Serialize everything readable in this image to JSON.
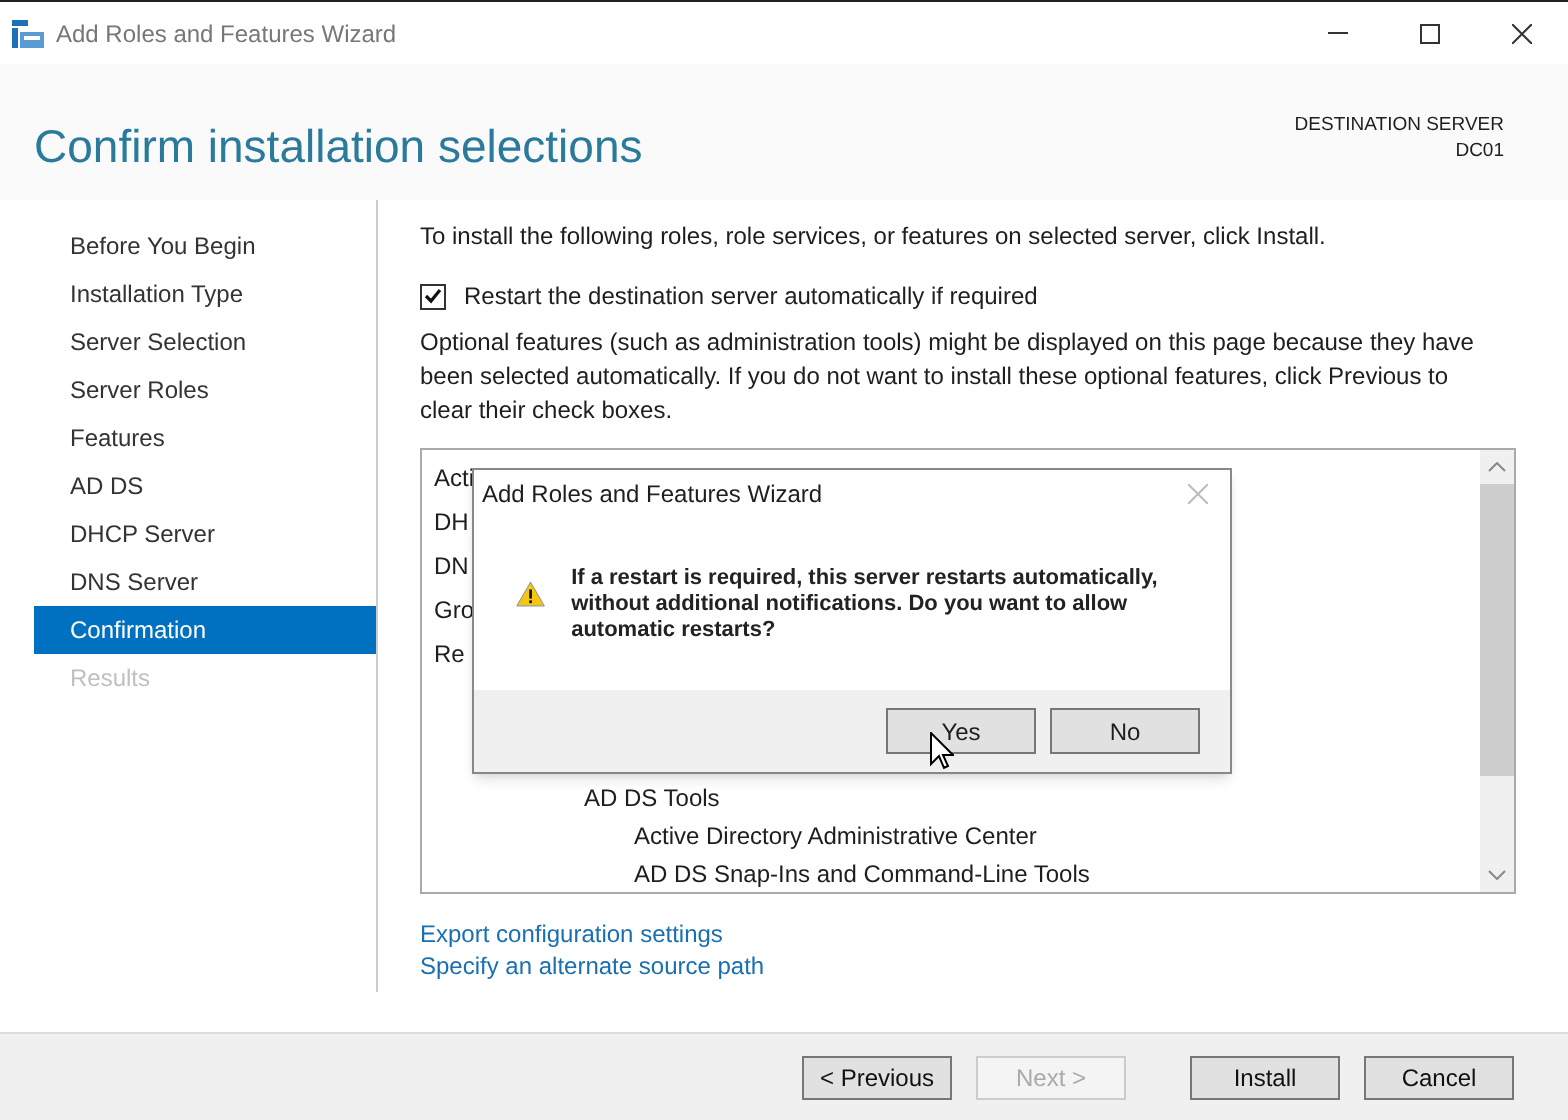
{
  "window": {
    "title": "Add Roles and Features Wizard"
  },
  "header": {
    "title": "Confirm installation selections",
    "destination_label": "DESTINATION SERVER",
    "destination_server": "DC01"
  },
  "nav": [
    {
      "label": "Before You Begin",
      "selected": false,
      "disabled": false
    },
    {
      "label": "Installation Type",
      "selected": false,
      "disabled": false
    },
    {
      "label": "Server Selection",
      "selected": false,
      "disabled": false
    },
    {
      "label": "Server Roles",
      "selected": false,
      "disabled": false
    },
    {
      "label": "Features",
      "selected": false,
      "disabled": false
    },
    {
      "label": "AD DS",
      "selected": false,
      "disabled": false
    },
    {
      "label": "DHCP Server",
      "selected": false,
      "disabled": false
    },
    {
      "label": "DNS Server",
      "selected": false,
      "disabled": false
    },
    {
      "label": "Confirmation",
      "selected": true,
      "disabled": false
    },
    {
      "label": "Results",
      "selected": false,
      "disabled": true
    }
  ],
  "intro": "To install the following roles, role services, or features on selected server, click Install.",
  "restart_option": {
    "label": "Restart the destination server automatically if required",
    "checked": true
  },
  "note": "Optional features (such as administration tools) might be displayed on this page because they have been selected automatically. If you do not want to install these optional features, click Previous to clear their check boxes.",
  "selections": [
    {
      "label": "Acti"
    },
    {
      "label": "DH"
    },
    {
      "label": "DN"
    },
    {
      "label": "Gro"
    },
    {
      "label": "Re",
      "children": [
        {
          "label": "AD DS Tools",
          "children": [
            {
              "label": "Active Directory Administrative Center"
            },
            {
              "label": "AD DS Snap-Ins and Command-Line Tools"
            }
          ]
        }
      ]
    }
  ],
  "links": [
    "Export configuration settings",
    "Specify an alternate source path"
  ],
  "buttons": [
    {
      "label": "< Previous",
      "disabled": false
    },
    {
      "label": "Next >",
      "disabled": true
    },
    {
      "label": "Install",
      "disabled": false
    },
    {
      "label": "Cancel",
      "disabled": false
    }
  ],
  "dialog": {
    "title": "Add Roles and Features Wizard",
    "message": "If a restart is required, this server restarts automatically, without additional notifications. Do you want to allow automatic restarts?",
    "buttons": [
      "Yes",
      "No"
    ]
  }
}
